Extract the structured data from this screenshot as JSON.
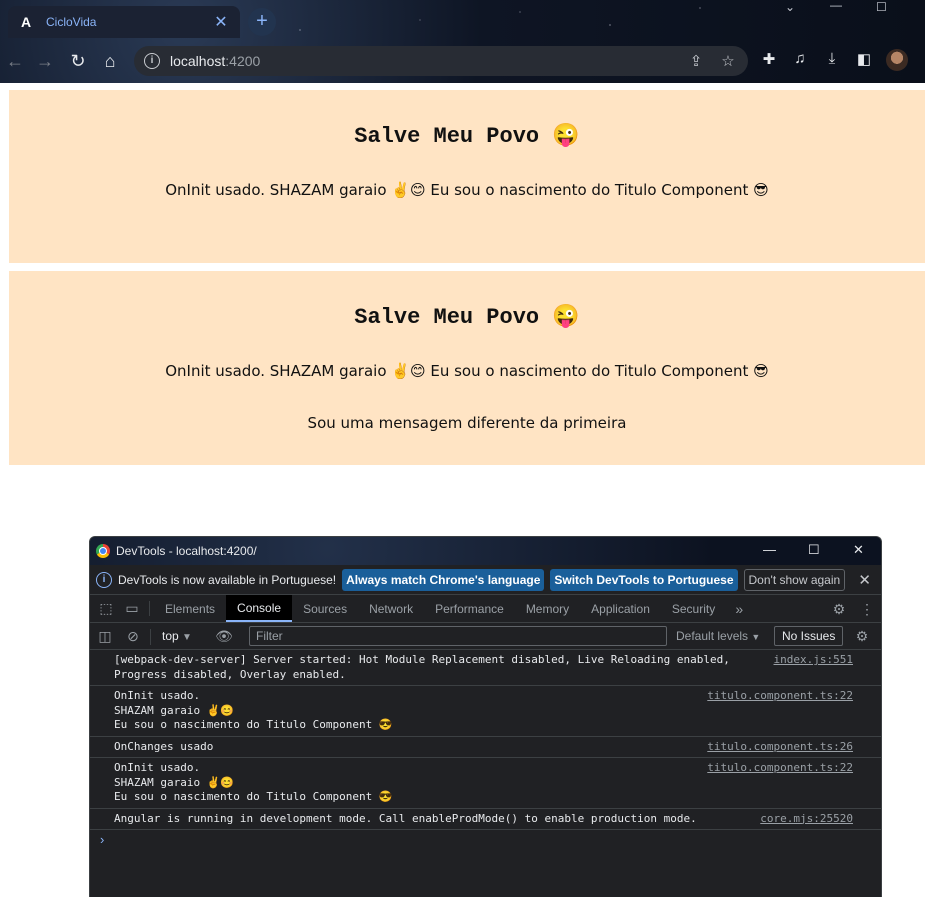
{
  "browser": {
    "tab_title": "CicloVida",
    "tab_logo": "A",
    "new_tab": "+",
    "url_host": "localhost",
    "url_port": ":4200"
  },
  "app": {
    "card1": {
      "title": "Salve Meu Povo 😜",
      "text": "OnInit usado. SHAZAM garaio ✌️😊 Eu sou o nascimento do Titulo Component 😎"
    },
    "card2": {
      "title": "Salve Meu Povo 😜",
      "text": "OnInit usado. SHAZAM garaio ✌️😊 Eu sou o nascimento do Titulo Component 😎",
      "extra": "Sou uma mensagem diferente da primeira"
    }
  },
  "devtools": {
    "title": "DevTools - localhost:4200/",
    "info_text": "DevTools is now available in Portuguese!",
    "btn_match": "Always match Chrome's language",
    "btn_switch": "Switch DevTools to Portuguese",
    "btn_dont": "Don't show again",
    "tabs": [
      "Elements",
      "Console",
      "Sources",
      "Network",
      "Performance",
      "Memory",
      "Application",
      "Security"
    ],
    "active_tab": "Console",
    "context": "top",
    "filter_placeholder": "Filter",
    "levels": "Default levels",
    "issues": "No Issues",
    "logs": [
      {
        "lines": [
          "[webpack-dev-server] Server started: Hot Module Replacement disabled, Live Reloading enabled,",
          "Progress disabled, Overlay enabled."
        ],
        "src": "index.js:551"
      },
      {
        "lines": [
          "OnInit usado.",
          "SHAZAM garaio ✌️😊",
          "Eu sou o nascimento do Titulo Component 😎"
        ],
        "src": "titulo.component.ts:22"
      },
      {
        "lines": [
          "OnChanges usado"
        ],
        "src": "titulo.component.ts:26"
      },
      {
        "lines": [
          "OnInit usado.",
          "SHAZAM garaio ✌️😊",
          "Eu sou o nascimento do Titulo Component 😎"
        ],
        "src": "titulo.component.ts:22"
      },
      {
        "lines": [
          "Angular is running in development mode. Call enableProdMode() to enable production mode."
        ],
        "src": "core.mjs:25520"
      }
    ]
  }
}
